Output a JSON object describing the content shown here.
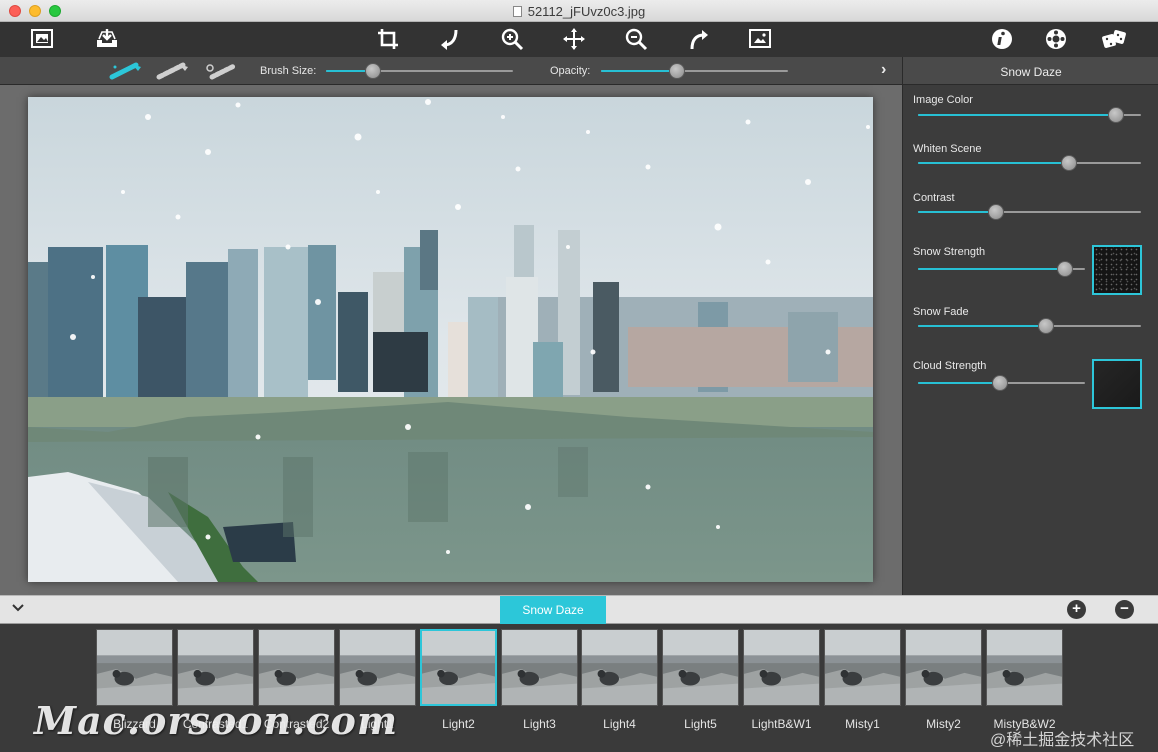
{
  "window": {
    "title": "52112_jFUvz0c3.jpg"
  },
  "toolbar": {
    "icons": [
      "open-image-icon",
      "save-image-icon",
      "crop-icon",
      "rotate-left-icon",
      "zoom-in-icon",
      "move-icon",
      "zoom-out-icon",
      "rotate-right-icon",
      "fit-image-icon",
      "info-icon",
      "settings-icon",
      "random-icon"
    ]
  },
  "brush": {
    "brush_size_label": "Brush Size:",
    "opacity_label": "Opacity:",
    "brush_size": 0.23,
    "opacity": 0.4
  },
  "panel": {
    "title": "Snow Daze",
    "params": [
      {
        "label": "Image Color",
        "value": 0.92
      },
      {
        "label": "Whiten Scene",
        "value": 0.69
      },
      {
        "label": "Contrast",
        "value": 0.34
      },
      {
        "label": "Snow Strength",
        "value": 0.92
      },
      {
        "label": "Snow Fade",
        "value": 0.58
      },
      {
        "label": "Cloud Strength",
        "value": 0.49
      }
    ],
    "accent_color": "#2cc7d9"
  },
  "strip": {
    "active_preset": "Snow Daze",
    "presets": [
      {
        "label": "Blizzard"
      },
      {
        "label": "Contrasted1"
      },
      {
        "label": "Contrasted2"
      },
      {
        "label": "Light1"
      },
      {
        "label": "Light2"
      },
      {
        "label": "Light3"
      },
      {
        "label": "Light4"
      },
      {
        "label": "Light5"
      },
      {
        "label": "LightB&W1"
      },
      {
        "label": "Misty1"
      },
      {
        "label": "Misty2"
      },
      {
        "label": "MistyB&W2"
      }
    ],
    "selected_index": 4,
    "add_label": "+",
    "remove_label": "−"
  },
  "watermarks": {
    "left": "Mac.orsoon.com",
    "right": "@稀土掘金技术社区"
  }
}
